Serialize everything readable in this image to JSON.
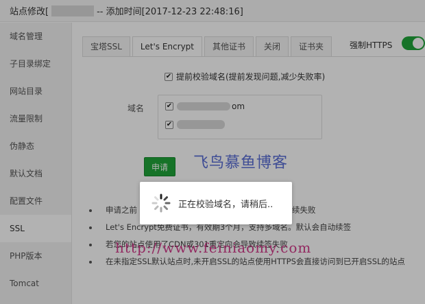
{
  "title": {
    "prefix": "站点修改[",
    "suffix": " -- 添加时间[2017-12-23 22:48:16]"
  },
  "sidebar": {
    "items": [
      {
        "label": "域名管理"
      },
      {
        "label": "子目录绑定"
      },
      {
        "label": "网站目录"
      },
      {
        "label": "流量限制"
      },
      {
        "label": "伪静态"
      },
      {
        "label": "默认文档"
      },
      {
        "label": "配置文件"
      },
      {
        "label": "SSL"
      },
      {
        "label": "PHP版本"
      },
      {
        "label": "Tomcat"
      }
    ],
    "active": "SSL"
  },
  "tabs": [
    {
      "label": "宝塔SSL"
    },
    {
      "label": "Let's Encrypt"
    },
    {
      "label": "其他证书"
    },
    {
      "label": "关闭"
    },
    {
      "label": "证书夹"
    }
  ],
  "active_tab": "Let's Encrypt",
  "force_https": {
    "label": "强制HTTPS",
    "enabled": true,
    "color": "#20a53a"
  },
  "verify_option": {
    "label": "提前校验域名(提前发现问题,减少失败率)",
    "checked": true
  },
  "domain": {
    "label": "域名",
    "items": [
      {
        "suffix": "om",
        "checked": true
      },
      {
        "suffix": "",
        "checked": true
      }
    ]
  },
  "apply_button": {
    "label": "申请",
    "color": "#20a53a"
  },
  "watermarks": {
    "blog_name": "飞鸟慕鱼博客",
    "url": "http://www.feiniaomy.com"
  },
  "notes": [
    "申请之前",
    "Let's Encrypt免费证书，有效期3个月，支持多域名。默认会自动续签",
    "若您的站点使用了CDN或301重定向会导致续签失败",
    "在未指定SSL默认站点时,未开启SSL的站点使用HTTPS会直接访问到已开启SSL的站点"
  ],
  "note_fragment": "续失败",
  "loading": {
    "text": "正在校验域名，请稍后.."
  }
}
